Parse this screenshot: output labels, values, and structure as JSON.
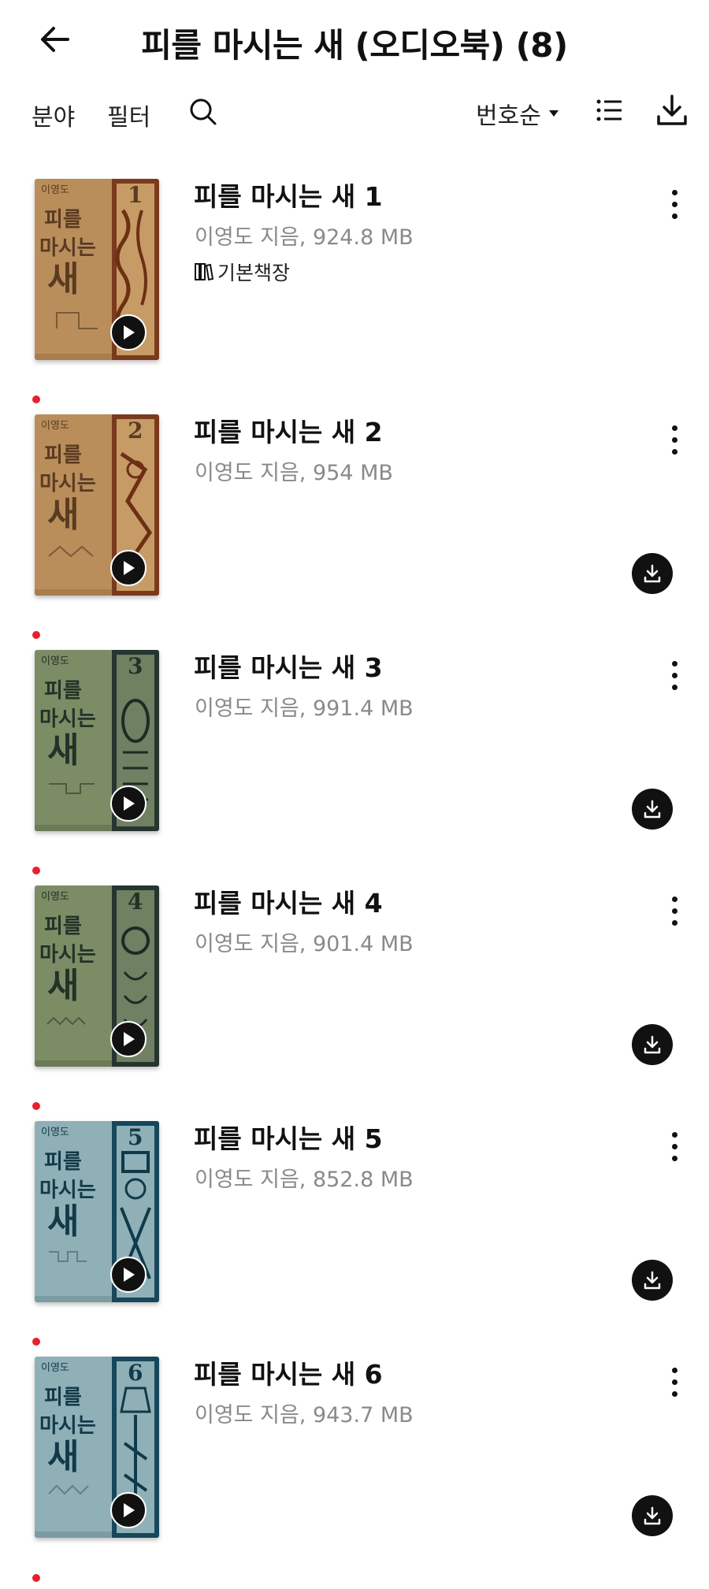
{
  "header": {
    "title": "피를 마시는 새 (오디오북) (8)",
    "back_icon": "arrow-left-icon"
  },
  "toolbar": {
    "field_label": "분야",
    "filter_label": "필터",
    "search_icon": "search-icon",
    "sort_label": "번호순",
    "sort_icon": "caret-down-icon",
    "list_icon": "list-view-icon",
    "download_icon": "download-icon"
  },
  "colors": {
    "accent": "#e8202c",
    "cover_tan": "#b98e5b",
    "cover_green": "#7c8c65",
    "cover_blue": "#8fb0b7"
  },
  "items": [
    {
      "cover_number": "1",
      "cover_author": "이영도",
      "cover_title": "피를 마시는 새",
      "title": "피를 마시는 새 1",
      "meta": "이영도 지음, 924.8 MB",
      "shelf": "기본책장",
      "is_new": false,
      "downloaded": true,
      "cover_color": "#b98e5b"
    },
    {
      "cover_number": "2",
      "cover_author": "이영도",
      "cover_title": "피를 마시는 새",
      "title": "피를 마시는 새 2",
      "meta": "이영도 지음, 954 MB",
      "shelf": "",
      "is_new": true,
      "downloaded": false,
      "cover_color": "#b98e5b"
    },
    {
      "cover_number": "3",
      "cover_author": "이영도",
      "cover_title": "피를 마시는 새",
      "title": "피를 마시는 새 3",
      "meta": "이영도 지음, 991.4 MB",
      "shelf": "",
      "is_new": true,
      "downloaded": false,
      "cover_color": "#7c8c65"
    },
    {
      "cover_number": "4",
      "cover_author": "이영도",
      "cover_title": "피를 마시는 새",
      "title": "피를 마시는 새 4",
      "meta": "이영도 지음, 901.4 MB",
      "shelf": "",
      "is_new": true,
      "downloaded": false,
      "cover_color": "#7c8c65"
    },
    {
      "cover_number": "5",
      "cover_author": "이영도",
      "cover_title": "피를 마시는 새",
      "title": "피를 마시는 새 5",
      "meta": "이영도 지음, 852.8 MB",
      "shelf": "",
      "is_new": true,
      "downloaded": false,
      "cover_color": "#8fb0b7"
    },
    {
      "cover_number": "6",
      "cover_author": "이영도",
      "cover_title": "피를 마시는 새",
      "title": "피를 마시는 새 6",
      "meta": "이영도 지음, 943.7 MB",
      "shelf": "",
      "is_new": true,
      "downloaded": false,
      "cover_color": "#8fb0b7"
    }
  ]
}
